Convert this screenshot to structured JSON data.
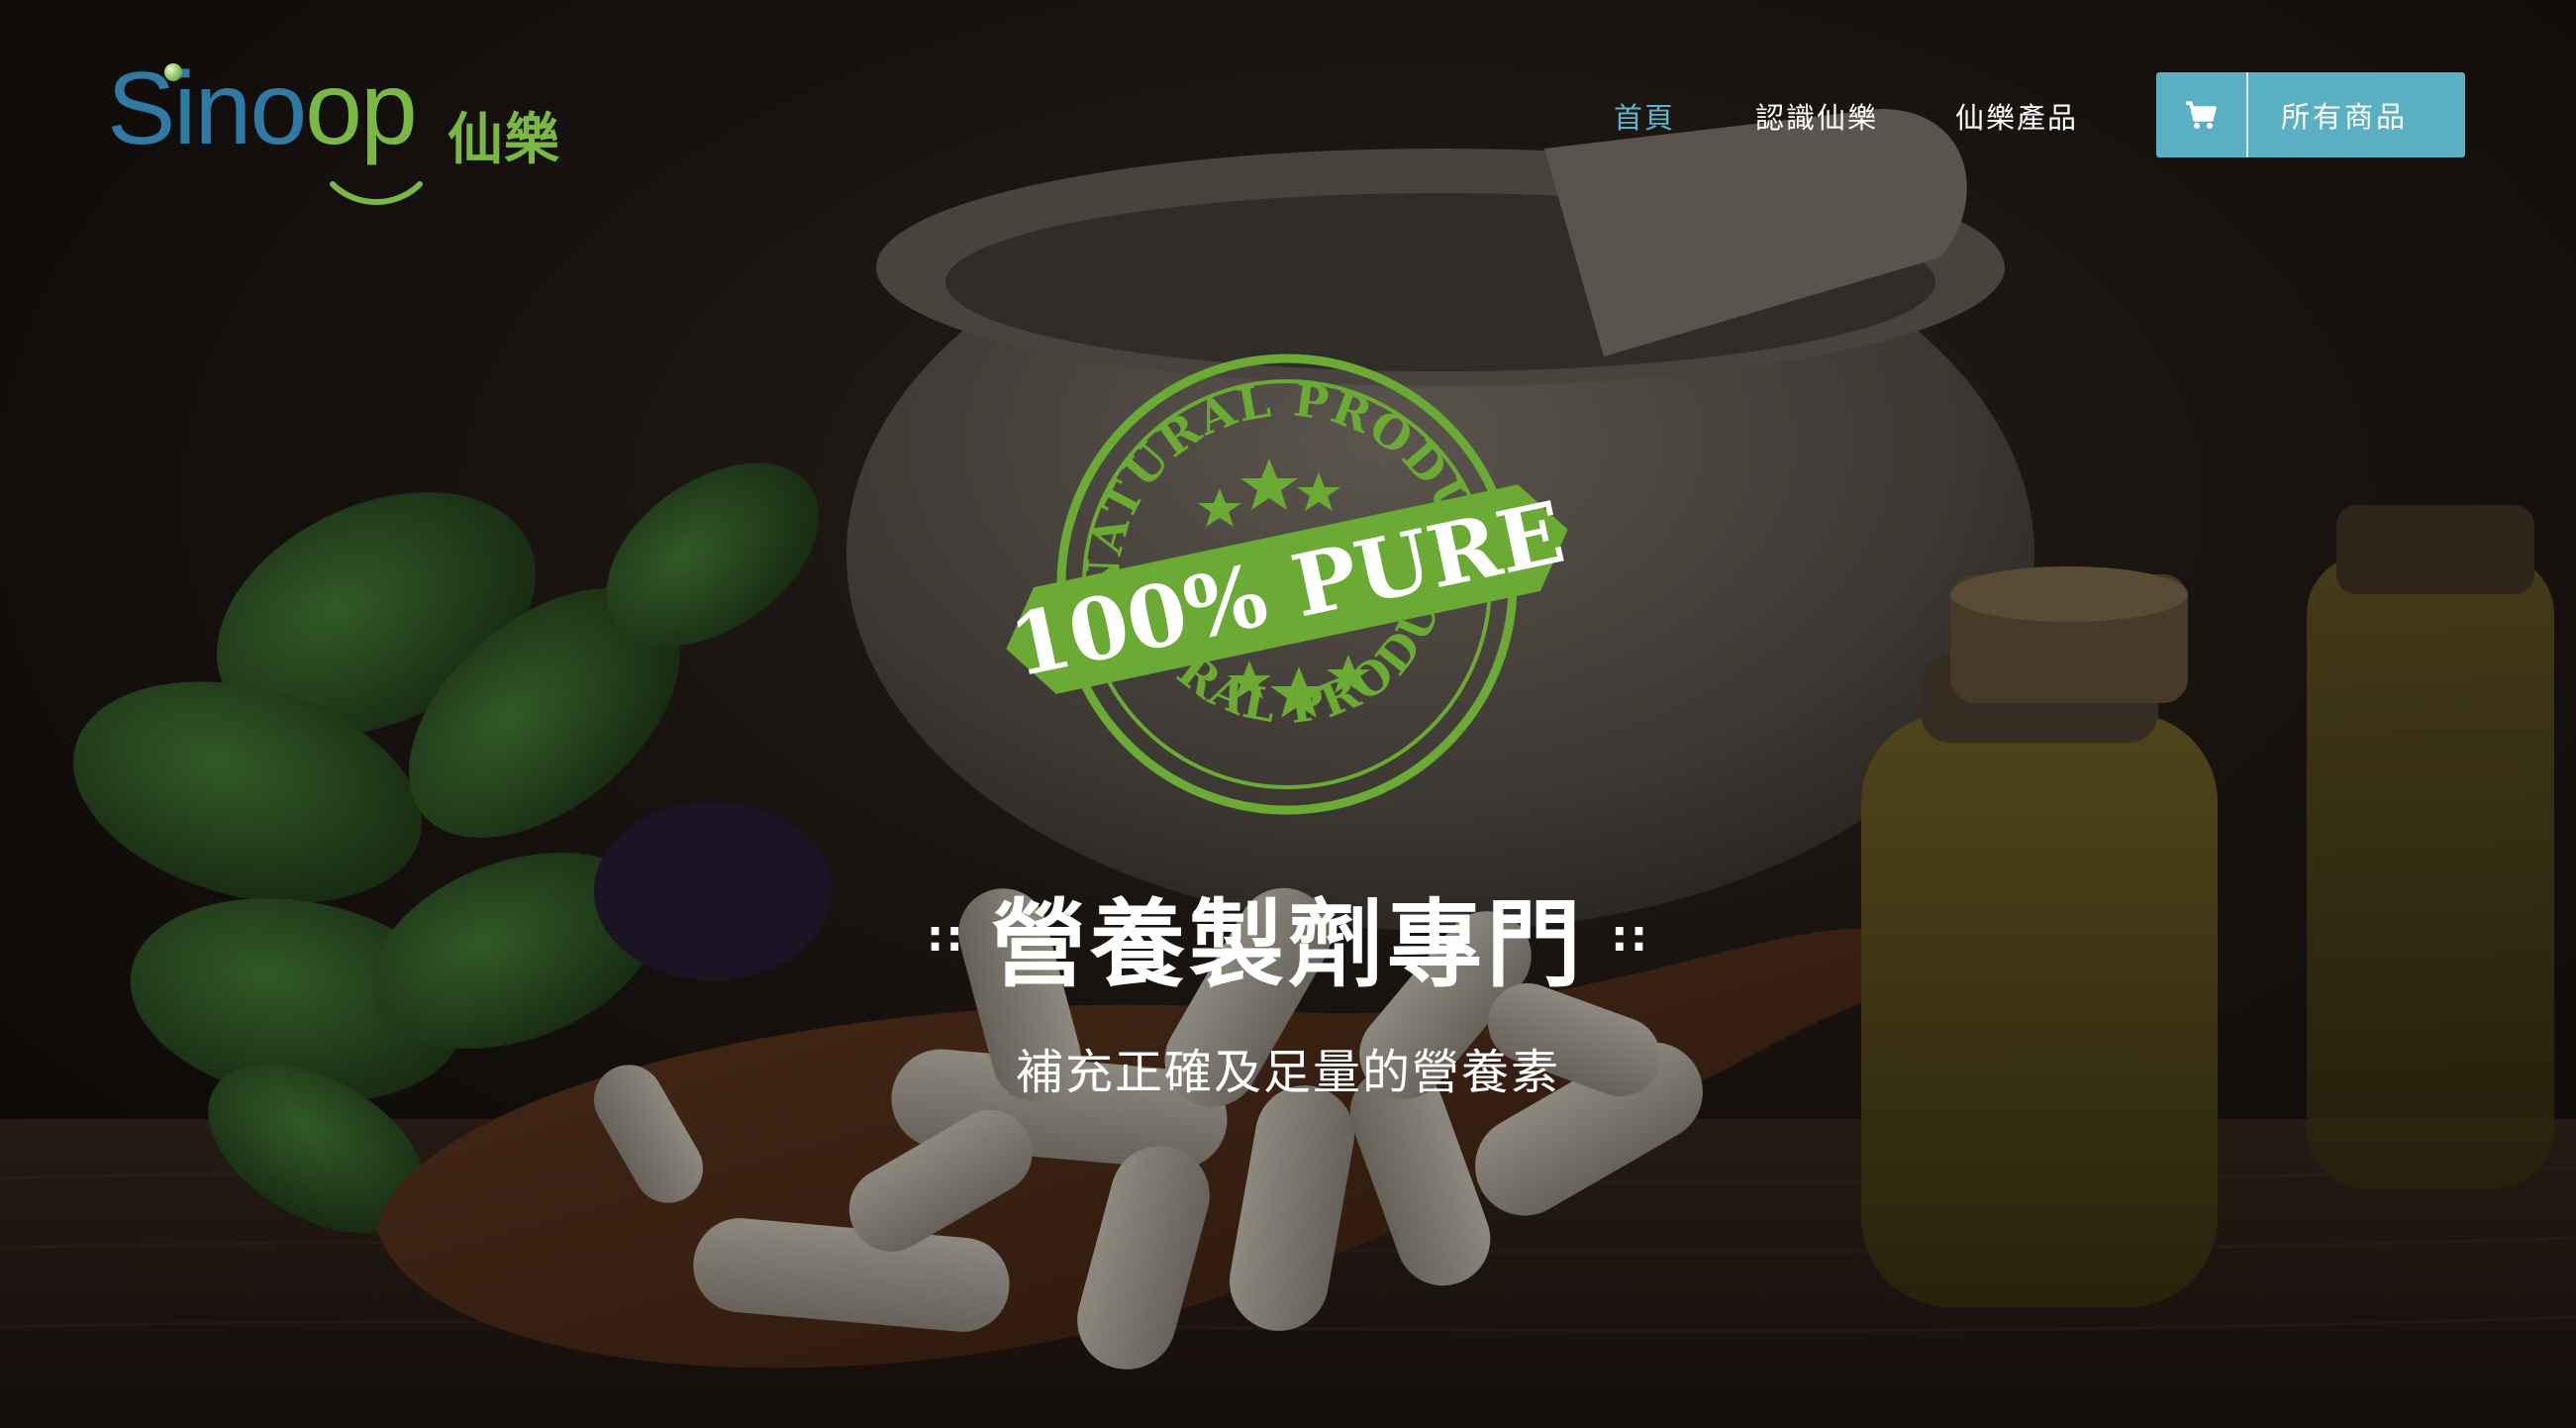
{
  "brand": {
    "logo_prefix": "Sino",
    "logo_suffix": "op",
    "logo_cjk": "仙樂"
  },
  "nav": {
    "items": [
      {
        "label": "首頁",
        "active": true
      },
      {
        "label": "認識仙樂",
        "active": false
      },
      {
        "label": "仙樂產品",
        "active": false
      }
    ]
  },
  "cart": {
    "icon": "shopping-cart-icon",
    "label": "所有商品"
  },
  "stamp": {
    "top_arc_text": "NATURAL PRODUCT",
    "banner_text": "100% PURE",
    "bottom_arc_text": "NATURAL PRODUCT"
  },
  "hero": {
    "decor_left": "::",
    "title": "營養製劑專門",
    "decor_right": "::",
    "subtitle": "補充正確及足量的營養素"
  },
  "colors": {
    "accent_teal": "#5aafc3",
    "nav_active": "#5bb7cf",
    "brand_blue": "#2f7aa4",
    "brand_green": "#79b843",
    "stamp_green": "#6aaa35"
  }
}
